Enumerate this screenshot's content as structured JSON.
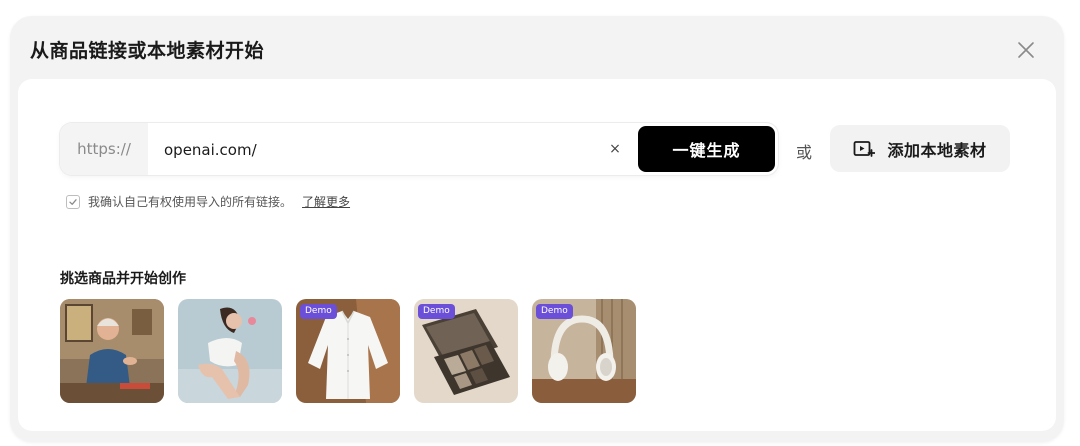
{
  "dialog": {
    "title": "从商品链接或本地素材开始"
  },
  "url_bar": {
    "prefix": "https://",
    "value": "openai.com/",
    "clear_symbol": "×",
    "generate_label": "一键生成"
  },
  "or_text": "或",
  "local_button": {
    "label": "添加本地素材",
    "icon": "add-video-icon"
  },
  "confirm": {
    "checked": true,
    "text": "我确认自己有权使用导入的所有链接。",
    "link": "了解更多"
  },
  "products": {
    "title": "挑选商品并开始创作",
    "items": [
      {
        "name": "man-speaking",
        "badge": ""
      },
      {
        "name": "woman-model",
        "badge": ""
      },
      {
        "name": "white-shirt",
        "badge": "Demo"
      },
      {
        "name": "eyeshadow-palette",
        "badge": "Demo"
      },
      {
        "name": "headphones",
        "badge": "Demo"
      }
    ]
  },
  "colors": {
    "badge": "#6b4fd8",
    "primary_button": "#000000"
  }
}
